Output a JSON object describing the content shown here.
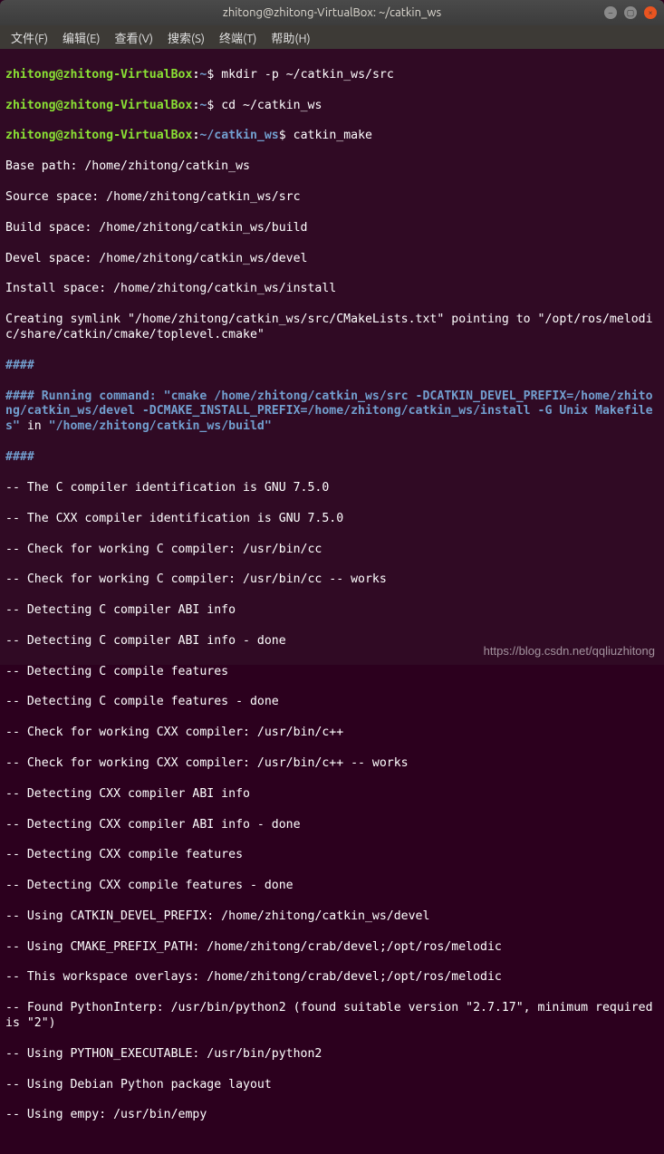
{
  "window": {
    "title": "zhitong@zhitong-VirtualBox: ~/catkin_ws"
  },
  "menubar": {
    "file": "文件(F)",
    "edit": "编辑(E)",
    "view": "查看(V)",
    "search": "搜索(S)",
    "terminal": "终端(T)",
    "help": "帮助(H)"
  },
  "prompt": {
    "user": "zhitong@zhitong-VirtualBox",
    "colon": ":",
    "home_path": "~",
    "ws_path": "~/catkin_ws",
    "dollar": "$"
  },
  "commands": {
    "c1": " mkdir -p ~/catkin_ws/src",
    "c2": " cd ~/catkin_ws",
    "c3": " catkin_make"
  },
  "output": {
    "l1": "Base path: /home/zhitong/catkin_ws",
    "l2": "Source space: /home/zhitong/catkin_ws/src",
    "l3": "Build space: /home/zhitong/catkin_ws/build",
    "l4": "Devel space: /home/zhitong/catkin_ws/devel",
    "l5": "Install space: /home/zhitong/catkin_ws/install",
    "l6": "Creating symlink \"/home/zhitong/catkin_ws/src/CMakeLists.txt\" pointing to \"/opt/ros/melodic/share/catkin/cmake/toplevel.cmake\"",
    "h1": "####",
    "h2a": "#### Running command: ",
    "h2b": "\"cmake /home/zhitong/catkin_ws/src -DCATKIN_DEVEL_PREFIX=/home/zhitong/catkin_ws/devel -DCMAKE_INSTALL_PREFIX=/home/zhitong/catkin_ws/install -G Unix Makefiles\"",
    "h2c": " in ",
    "h2d": "\"/home/zhitong/catkin_ws/build\"",
    "h3": "####",
    "l7": "-- The C compiler identification is GNU 7.5.0",
    "l8": "-- The CXX compiler identification is GNU 7.5.0",
    "l9": "-- Check for working C compiler: /usr/bin/cc",
    "l10": "-- Check for working C compiler: /usr/bin/cc -- works",
    "l11": "-- Detecting C compiler ABI info",
    "l12": "-- Detecting C compiler ABI info - done",
    "l13": "-- Detecting C compile features",
    "l14": "-- Detecting C compile features - done",
    "l15": "-- Check for working CXX compiler: /usr/bin/c++",
    "l16": "-- Check for working CXX compiler: /usr/bin/c++ -- works",
    "l17": "-- Detecting CXX compiler ABI info",
    "l18": "-- Detecting CXX compiler ABI info - done",
    "l19": "-- Detecting CXX compile features",
    "l20": "-- Detecting CXX compile features - done",
    "l21": "-- Using CATKIN_DEVEL_PREFIX: /home/zhitong/catkin_ws/devel",
    "l22": "-- Using CMAKE_PREFIX_PATH: /home/zhitong/crab/devel;/opt/ros/melodic",
    "l23": "-- This workspace overlays: /home/zhitong/crab/devel;/opt/ros/melodic",
    "l24": "-- Found PythonInterp: /usr/bin/python2 (found suitable version \"2.7.17\", minimum required is \"2\")",
    "l25": "-- Using PYTHON_EXECUTABLE: /usr/bin/python2",
    "l26": "-- Using Debian Python package layout",
    "l27": "-- Using empy: /usr/bin/empy"
  },
  "watermark": "https://blog.csdn.net/qqliuzhitong"
}
